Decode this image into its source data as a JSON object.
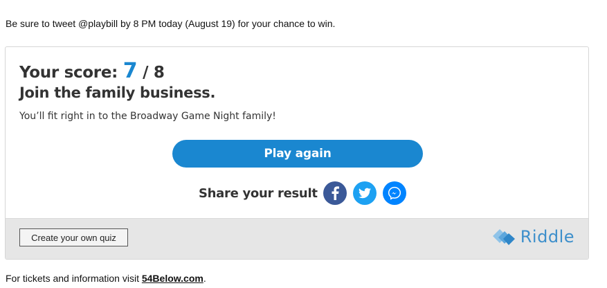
{
  "intro_text": "Be sure to tweet @playbill by 8 PM today (August 19) for your chance to win.",
  "quiz": {
    "score_prefix": "Your score:",
    "score_value": "7",
    "score_total": "/ 8",
    "result_title": "Join the family business.",
    "result_description": "You’ll fit right in to the Broadway Game Night family!",
    "play_again_label": "Play again",
    "share_label": "Share your result",
    "share_icons": [
      "facebook-icon",
      "twitter-icon",
      "messenger-icon"
    ],
    "create_quiz_label": "Create your own quiz",
    "brand_name": "Riddle",
    "accent_color": "#1a87d0"
  },
  "outro": {
    "text": "For tickets and information visit",
    "link_text": "54Below.com",
    "suffix": "."
  }
}
